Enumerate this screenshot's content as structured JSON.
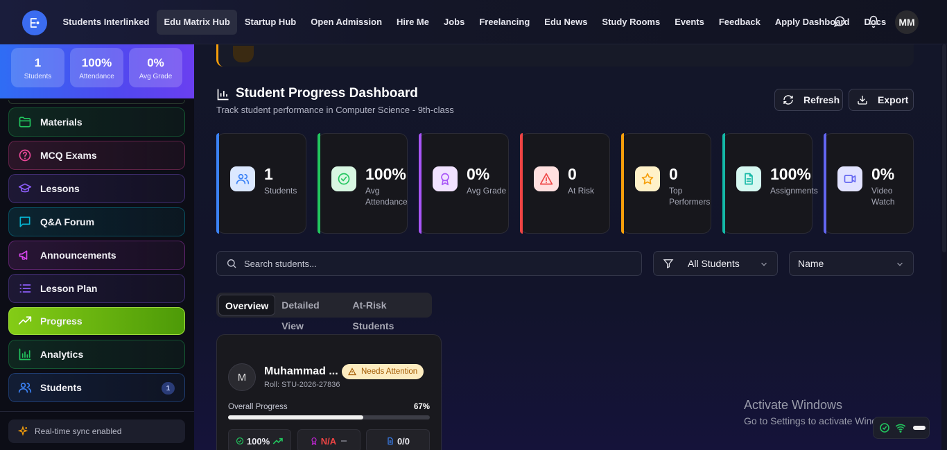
{
  "nav": {
    "links": [
      "Students Interlinked",
      "Edu Matrix Hub",
      "Startup Hub",
      "Open Admission",
      "Hire Me",
      "Jobs",
      "Freelancing",
      "Edu News",
      "Study Rooms",
      "Events",
      "Feedback",
      "Apply Dashboard",
      "Docs"
    ],
    "active": "Edu Matrix Hub",
    "user_initials": "MM",
    "icons": [
      "logo-icon",
      "message-icon",
      "bell-icon"
    ]
  },
  "sidebar": {
    "stats": [
      {
        "value": "1",
        "label": "Students"
      },
      {
        "value": "100%",
        "label": "Attendance"
      },
      {
        "value": "0%",
        "label": "Avg Grade"
      }
    ],
    "items": [
      {
        "label": "Materials",
        "icon": "folder-icon",
        "color": "#22c55e"
      },
      {
        "label": "MCQ Exams",
        "icon": "help-circle-icon",
        "color": "#ec4899"
      },
      {
        "label": "Lessons",
        "icon": "graduation-cap-icon",
        "color": "#8b5cf6"
      },
      {
        "label": "Q&A Forum",
        "icon": "message-square-icon",
        "color": "#06b6d4"
      },
      {
        "label": "Announcements",
        "icon": "megaphone-icon",
        "color": "#d946ef"
      },
      {
        "label": "Lesson Plan",
        "icon": "list-icon",
        "color": "#8b5cf6"
      },
      {
        "label": "Progress",
        "icon": "trending-up-icon",
        "color": "#84cc16"
      },
      {
        "label": "Analytics",
        "icon": "bar-chart-icon",
        "color": "#22c55e"
      },
      {
        "label": "Students",
        "icon": "users-icon",
        "color": "#3b82f6",
        "badge": "1"
      }
    ],
    "active": "Progress",
    "sync_text": "Real-time sync enabled"
  },
  "dashboard": {
    "title": "Student Progress Dashboard",
    "subtitle": "Track student performance in Computer Science - 9th-class",
    "refresh_label": "Refresh",
    "export_label": "Export"
  },
  "cards": [
    {
      "value": "1",
      "label": "Students",
      "color": "#3b82f6",
      "icon": "users-icon"
    },
    {
      "value": "100%",
      "label": "Avg Attendance",
      "color": "#22c55e",
      "icon": "check-circle-icon"
    },
    {
      "value": "0%",
      "label": "Avg Grade",
      "color": "#a855f7",
      "icon": "award-icon"
    },
    {
      "value": "0",
      "label": "At Risk",
      "color": "#ef4444",
      "icon": "alert-triangle-icon"
    },
    {
      "value": "0",
      "label": "Top Performers",
      "color": "#f59e0b",
      "icon": "star-icon"
    },
    {
      "value": "100%",
      "label": "Assignments",
      "color": "#14b8a6",
      "icon": "file-text-icon"
    },
    {
      "value": "0%",
      "label": "Video Watch",
      "color": "#6366f1",
      "icon": "video-icon"
    }
  ],
  "filters": {
    "search_placeholder": "Search students...",
    "group_value": "All Students",
    "sort_value": "Name"
  },
  "tabs": [
    "Overview",
    "Detailed View",
    "At-Risk Students"
  ],
  "active_tab": "Overview",
  "student": {
    "initial": "M",
    "name": "Muhammad ...",
    "roll": "Roll: STU-2026-27836",
    "badge": "Needs Attention",
    "progress_label": "Overall Progress",
    "progress_text": "67%",
    "progress_value": 0.67,
    "attendance": "100%",
    "grade": "N/A",
    "assignments": "0/0"
  },
  "watermark": {
    "line1": "Activate Windows",
    "line2": "Go to Settings to activate Windows."
  }
}
